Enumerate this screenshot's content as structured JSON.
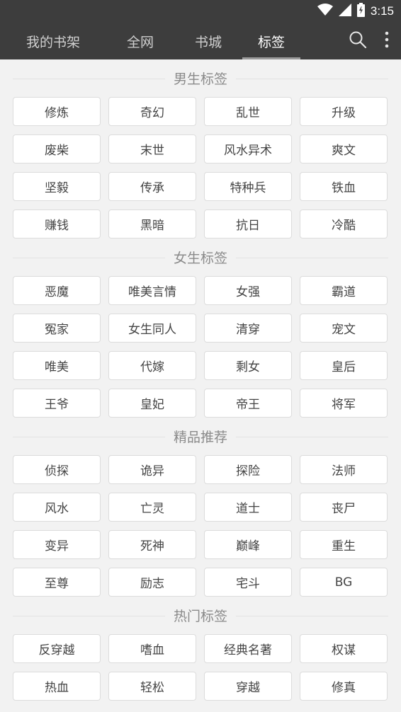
{
  "status_bar": {
    "time": "3:15"
  },
  "tabs": [
    {
      "label": "我的书架",
      "active": false
    },
    {
      "label": "全网",
      "active": false
    },
    {
      "label": "书城",
      "active": false
    },
    {
      "label": "标签",
      "active": true
    }
  ],
  "sections": [
    {
      "title": "男生标签",
      "tags": [
        "修炼",
        "奇幻",
        "乱世",
        "升级",
        "废柴",
        "末世",
        "风水异术",
        "爽文",
        "坚毅",
        "传承",
        "特种兵",
        "铁血",
        "赚钱",
        "黑暗",
        "抗日",
        "冷酷"
      ]
    },
    {
      "title": "女生标签",
      "tags": [
        "恶魔",
        "唯美言情",
        "女强",
        "霸道",
        "冤家",
        "女生同人",
        "清穿",
        "宠文",
        "唯美",
        "代嫁",
        "剩女",
        "皇后",
        "王爷",
        "皇妃",
        "帝王",
        "将军"
      ]
    },
    {
      "title": "精品推荐",
      "tags": [
        "侦探",
        "诡异",
        "探险",
        "法师",
        "风水",
        "亡灵",
        "道士",
        "丧尸",
        "变异",
        "死神",
        "巅峰",
        "重生",
        "至尊",
        "励志",
        "宅斗",
        "BG"
      ]
    },
    {
      "title": "热门标签",
      "tags": [
        "反穿越",
        "嗜血",
        "经典名著",
        "权谋",
        "热血",
        "轻松",
        "穿越",
        "修真"
      ]
    }
  ],
  "icons": {
    "search": "search-icon",
    "more": "more-vert-icon",
    "wifi": "wifi-icon",
    "signal": "signal-icon",
    "battery": "battery-icon"
  },
  "colors": {
    "app_bar": "#3d3d3d",
    "background": "#f2f2f2",
    "tag_border": "#dcdcdc"
  }
}
